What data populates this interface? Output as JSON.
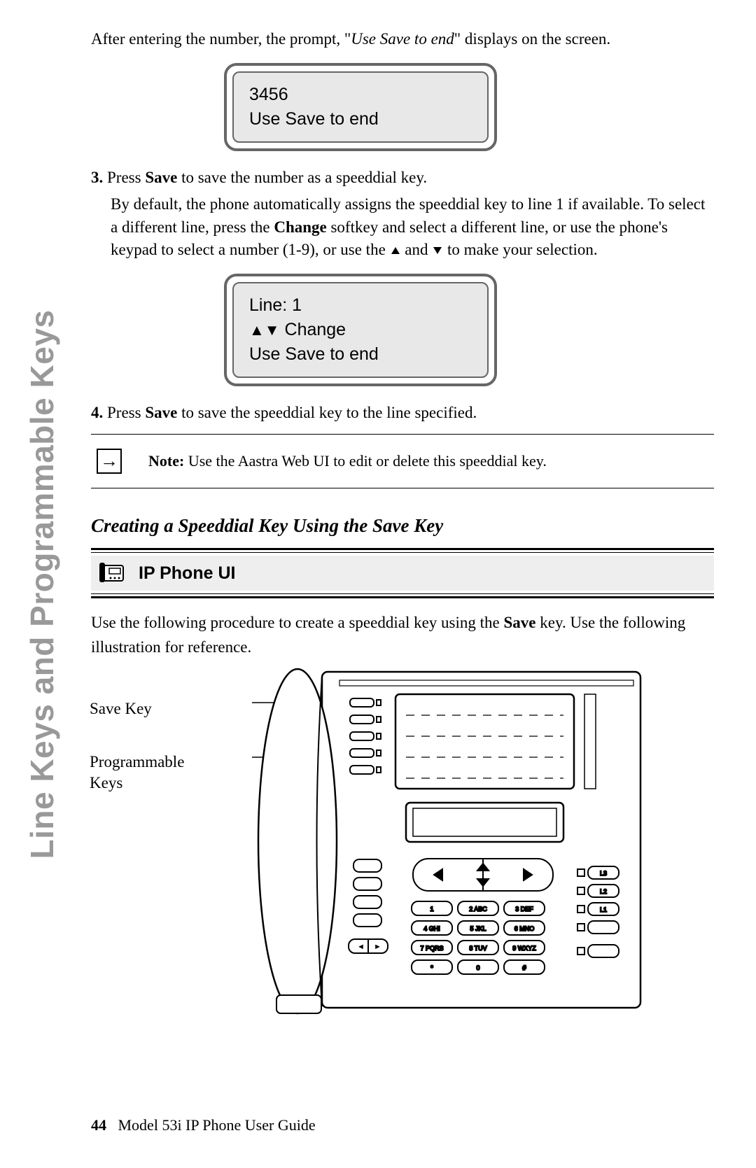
{
  "sideTab": "Line Keys and Programmable Keys",
  "intro": {
    "pre": "After entering the number, the prompt, \"",
    "em": "Use Save to end",
    "post": "\" displays on the screen."
  },
  "lcd1": {
    "line1": "3456",
    "line2": "Use Save to end"
  },
  "step3": {
    "num": "3.",
    "lead": "Press ",
    "b1": "Save",
    "t1": " to save the number as a speeddial key.",
    "body1": "By default, the phone automatically assigns the speeddial key to line 1 if available. To select a different line, press the ",
    "b2": "Change",
    "body2": " softkey and select a different line, or use the phone's keypad to select a number (1-9), or use the ",
    "and": " and ",
    "body3": " to make your selection."
  },
  "lcd2": {
    "line1": "Line: 1",
    "arrows": "▲▼",
    "line2b": " Change",
    "line3": "Use Save to end"
  },
  "step4": {
    "num": "4.",
    "lead": "Press ",
    "b1": "Save",
    "t1": " to save the speeddial key to the line specified."
  },
  "note": {
    "label": "Note: ",
    "text": "Use the Aastra Web UI to edit or delete this speeddial key."
  },
  "section2": "Creating a Speeddial Key Using the Save Key",
  "uiBar": "IP Phone UI",
  "proc": {
    "t1": "Use the following procedure to create a speeddial key using the ",
    "b1": "Save",
    "t2": " key. Use the following illustration for reference."
  },
  "callouts": {
    "save": "Save Key",
    "prog1": "Programmable",
    "prog2": "Keys"
  },
  "keypad": {
    "r1": [
      "1",
      "2 ABC",
      "3 DEF"
    ],
    "r2": [
      "4 GHI",
      "5 JKL",
      "6 MNO"
    ],
    "r3": [
      "7 PQRS",
      "8 TUV",
      "9 WXYZ"
    ],
    "r4": [
      "*",
      "0",
      "#"
    ]
  },
  "lineBtns": [
    "L3",
    "L2",
    "L1"
  ],
  "footer": {
    "page": "44",
    "title": "Model 53i IP Phone User Guide"
  }
}
